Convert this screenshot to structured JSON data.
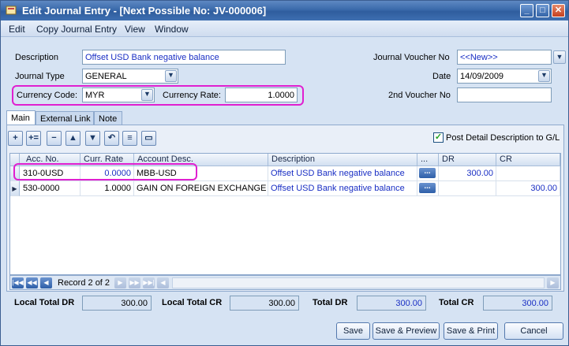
{
  "window": {
    "title": "Edit Journal Entry - [Next Possible No: JV-000006]",
    "minimize": "_",
    "maximize": "□",
    "close": "✕"
  },
  "menu": [
    "Edit",
    "Copy Journal Entry",
    "View",
    "Window"
  ],
  "form": {
    "description_label": "Description",
    "description_value": "Offset USD Bank negative balance",
    "journal_type_label": "Journal Type",
    "journal_type_value": "GENERAL",
    "currency_code_label": "Currency Code:",
    "currency_code_value": "MYR",
    "currency_rate_label": "Currency Rate:",
    "currency_rate_value": "1.0000",
    "jv_no_label": "Journal Voucher No",
    "jv_no_value": "<<New>>",
    "date_label": "Date",
    "date_value": "14/09/2009",
    "second_voucher_label": "2nd Voucher No",
    "second_voucher_value": ""
  },
  "tabs": [
    "Main",
    "External Link",
    "Note"
  ],
  "toolbar": {
    "post_detail_label": "Post Detail Description to G/L",
    "post_detail_checked": true
  },
  "grid": {
    "columns": [
      "Acc. No.",
      "Curr. Rate",
      "Account Desc.",
      "Description",
      "...",
      "DR",
      "CR"
    ],
    "rows": [
      {
        "acc_no": "310-0USD",
        "curr_rate": "0.0000",
        "account_desc": "MBB-USD",
        "description": "Offset USD Bank negative balance",
        "dr": "300.00",
        "cr": ""
      },
      {
        "acc_no": "530-0000",
        "curr_rate": "1.0000",
        "account_desc": "GAIN ON FOREIGN EXCHANGE",
        "description": "Offset USD Bank negative balance",
        "dr": "",
        "cr": "300.00"
      }
    ],
    "ellipsis": "..."
  },
  "navigator": {
    "record_text": "Record 2 of 2"
  },
  "totals": {
    "local_total_dr_label": "Local Total DR",
    "local_total_dr": "300.00",
    "local_total_cr_label": "Local Total CR",
    "local_total_cr": "300.00",
    "total_dr_label": "Total DR",
    "total_dr": "300.00",
    "total_cr_label": "Total CR",
    "total_cr": "300.00"
  },
  "buttons": {
    "save": "Save",
    "save_preview": "Save & Preview",
    "save_print": "Save & Print",
    "cancel": "Cancel"
  },
  "colors": {
    "highlight": "#e020d0",
    "link_text": "#1a2fc4",
    "title_bar": "#3a6aab"
  }
}
